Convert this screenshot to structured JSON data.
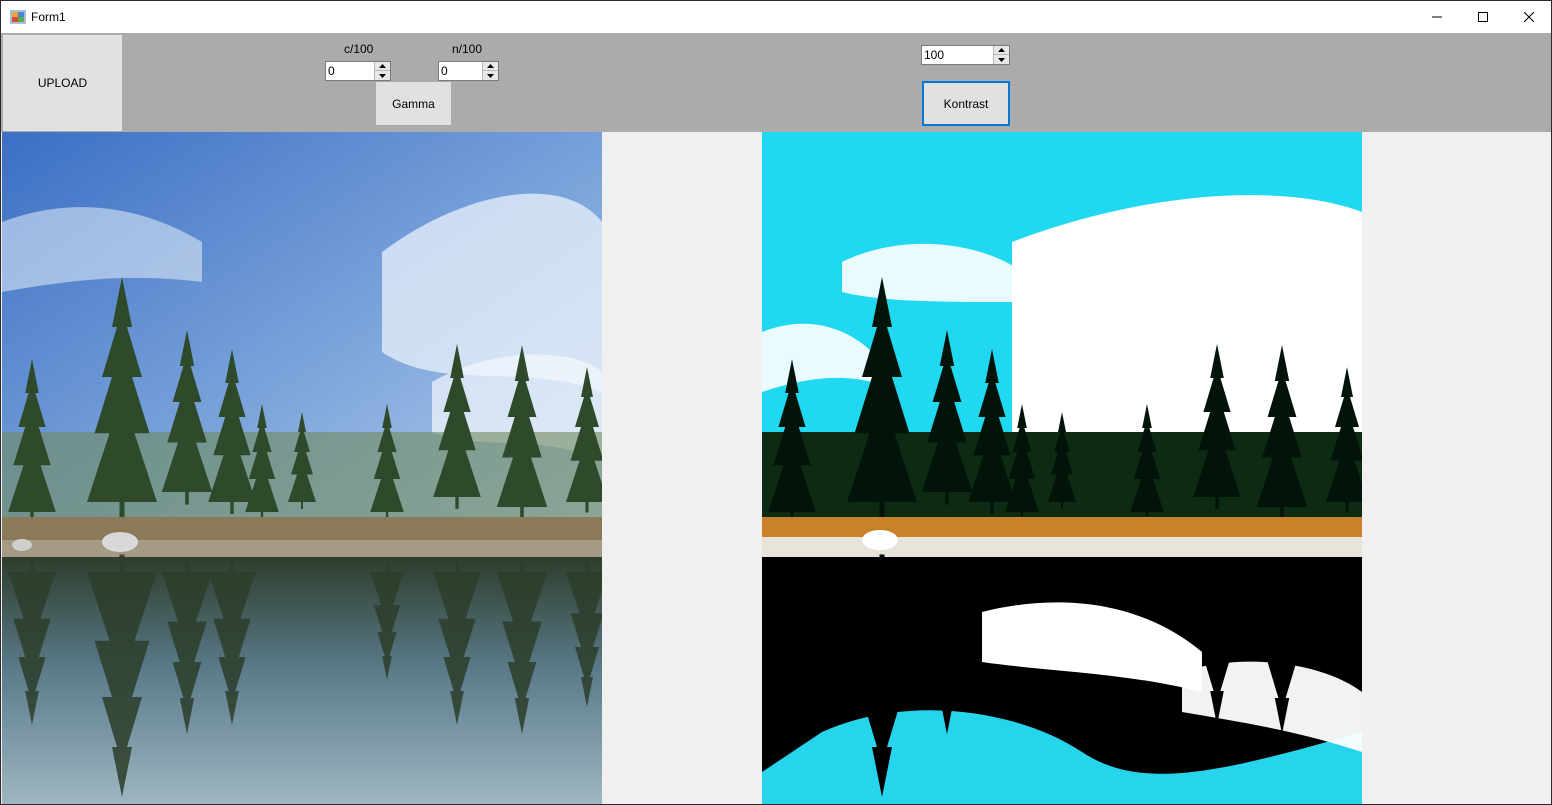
{
  "window": {
    "title": "Form1"
  },
  "toolbar": {
    "upload_label": "UPLOAD",
    "c_label": "c/100",
    "c_value": "0",
    "n_label": "n/100",
    "n_value": "0",
    "gamma_label": "Gamma",
    "contrast_value": "100",
    "kontrast_label": "Kontrast"
  },
  "icons": {
    "minimize": "minimize-icon",
    "maximize": "maximize-icon",
    "close": "close-icon",
    "app": "app-form-icon"
  },
  "colors": {
    "toolbar_bg": "#ababab",
    "accent_border": "#0078d7",
    "button_bg": "#e1e1e1"
  }
}
